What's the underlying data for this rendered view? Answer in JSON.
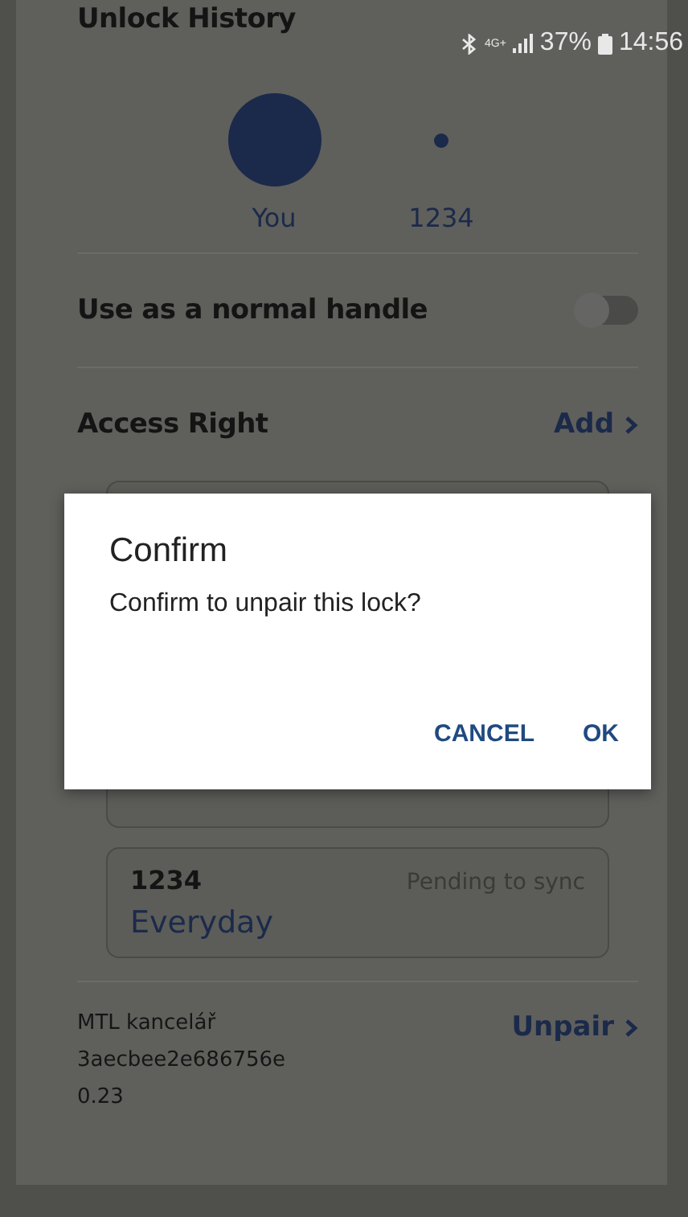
{
  "status_bar": {
    "signal": "4G+",
    "battery": "37%",
    "time": "14:56"
  },
  "unlock_history": {
    "title": "Unlock History",
    "users": [
      {
        "label": "You",
        "large": true
      },
      {
        "label": "1234",
        "large": false
      }
    ]
  },
  "normal_handle": {
    "label": "Use as a normal handle",
    "on": false
  },
  "access_right": {
    "title": "Access Right",
    "action": "Add",
    "entries": [
      {
        "name": "1234",
        "status": "Pending to sync",
        "schedule": "Everyday"
      }
    ]
  },
  "lock": {
    "name": "MTL kancelář",
    "id": "3aecbee2e686756e",
    "version": "0.23",
    "action": "Unpair"
  },
  "dialog": {
    "title": "Confirm",
    "message": "Confirm to unpair this lock?",
    "buttons": [
      "CANCEL",
      "OK"
    ]
  }
}
